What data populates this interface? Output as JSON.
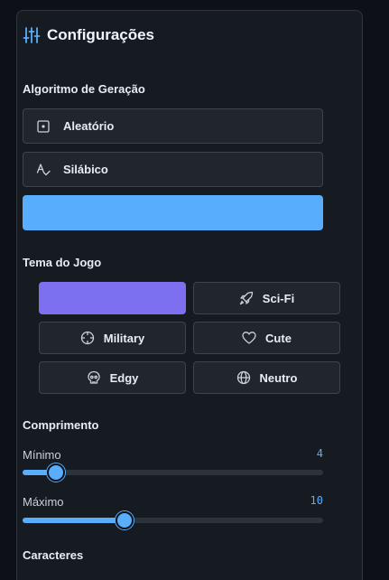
{
  "panel": {
    "title": "Configurações",
    "icon": "sliders-icon"
  },
  "algorithm": {
    "label": "Algoritmo de Geração",
    "options": [
      {
        "label": "Aleatório",
        "icon": "dice-icon",
        "active": false
      },
      {
        "label": "Silábico",
        "icon": "spell-check-icon",
        "active": false
      },
      {
        "label": "",
        "icon": "",
        "active": true
      }
    ]
  },
  "theme": {
    "label": "Tema do Jogo",
    "options": [
      {
        "label": "",
        "icon": "",
        "active": true
      },
      {
        "label": "Sci-Fi",
        "icon": "rocket-icon",
        "active": false
      },
      {
        "label": "Military",
        "icon": "crosshair-icon",
        "active": false
      },
      {
        "label": "Cute",
        "icon": "heart-icon",
        "active": false
      },
      {
        "label": "Edgy",
        "icon": "skull-icon",
        "active": false
      },
      {
        "label": "Neutro",
        "icon": "globe-icon",
        "active": false
      }
    ]
  },
  "length": {
    "label": "Comprimento",
    "min": {
      "label": "Mínimo",
      "value": "4",
      "fraction": 0.11
    },
    "max": {
      "label": "Máximo",
      "value": "10",
      "fraction": 0.34
    }
  },
  "characters": {
    "label": "Caracteres"
  },
  "colors": {
    "accent": "#58aefc",
    "theme_active": "#7c6ff0",
    "panel": "#161b22",
    "button": "#21262d"
  }
}
